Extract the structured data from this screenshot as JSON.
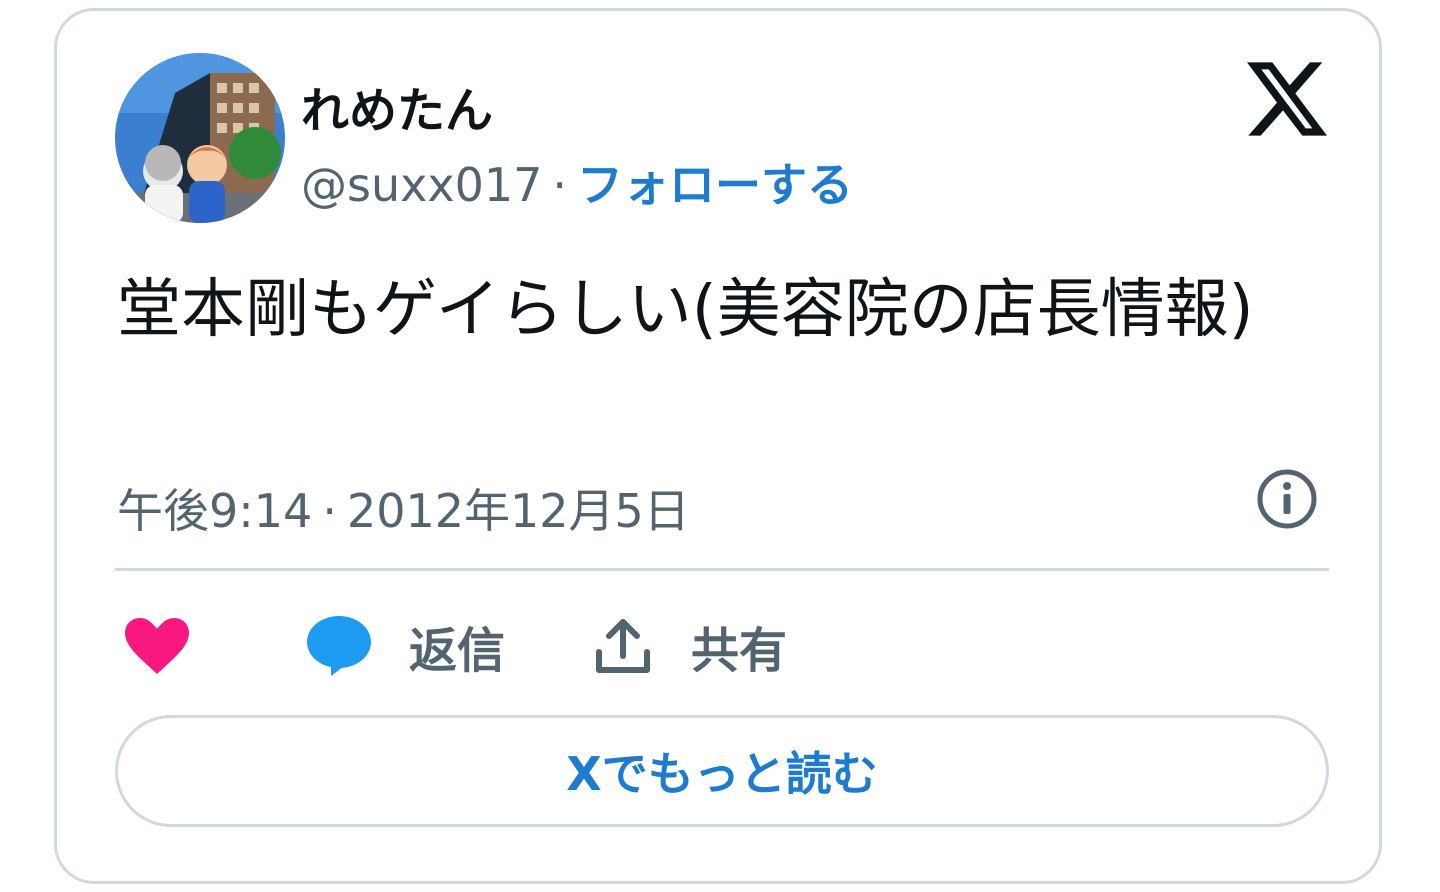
{
  "author": {
    "display_name": "れめたん",
    "handle": "@suxx017",
    "separator": "·",
    "follow_label": "フォローする"
  },
  "tweet": {
    "text": "堂本剛もゲイらしい(美容院の店長情報)",
    "time": "午後9:14",
    "separator": "·",
    "date": "2012年12月5日"
  },
  "actions": {
    "like_icon": "heart-icon",
    "reply_icon": "speech-bubble-icon",
    "reply_label": "返信",
    "share_icon": "upload-icon",
    "share_label": "共有"
  },
  "read_more_label": "Xでもっと読む",
  "colors": {
    "accent": "#1d7bd0",
    "like": "#f91880",
    "reply": "#1d9bf0",
    "text_primary": "#0f1419",
    "text_secondary": "#536471",
    "border": "#cfd9de"
  }
}
